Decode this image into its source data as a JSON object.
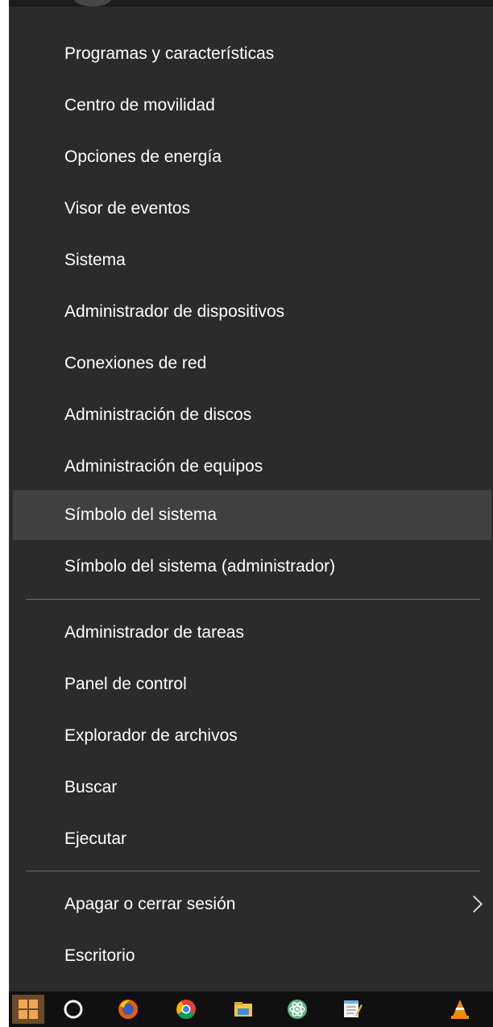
{
  "menu": {
    "items": [
      {
        "label": "Programas y características"
      },
      {
        "label": "Centro de movilidad"
      },
      {
        "label": "Opciones de energía"
      },
      {
        "label": "Visor de eventos"
      },
      {
        "label": "Sistema"
      },
      {
        "label": "Administrador de dispositivos"
      },
      {
        "label": "Conexiones de red"
      },
      {
        "label": "Administración de discos"
      },
      {
        "label": "Administración de equipos"
      },
      {
        "label": "Símbolo del sistema",
        "highlighted": true
      },
      {
        "label": "Símbolo del sistema (administrador)"
      },
      {
        "label": "Administrador de tareas"
      },
      {
        "label": "Panel de control"
      },
      {
        "label": "Explorador de archivos"
      },
      {
        "label": "Buscar"
      },
      {
        "label": "Ejecutar"
      },
      {
        "label": "Apagar o cerrar sesión",
        "has_submenu": true
      },
      {
        "label": "Escritorio"
      }
    ]
  },
  "taskbar": {
    "icons": [
      {
        "name": "windows-start-icon"
      },
      {
        "name": "cortana-search-icon"
      },
      {
        "name": "firefox-icon"
      },
      {
        "name": "chrome-icon"
      },
      {
        "name": "file-explorer-icon"
      },
      {
        "name": "atom-icon"
      },
      {
        "name": "notepad-icon"
      },
      {
        "name": "vlc-icon"
      }
    ]
  },
  "colors": {
    "menu_background": "#2b2b2b",
    "highlight_background": "#414141",
    "text": "#ffffff",
    "separator": "#6a6a6a",
    "taskbar_background": "#101010",
    "start_button_background": "#6b4a2b"
  }
}
